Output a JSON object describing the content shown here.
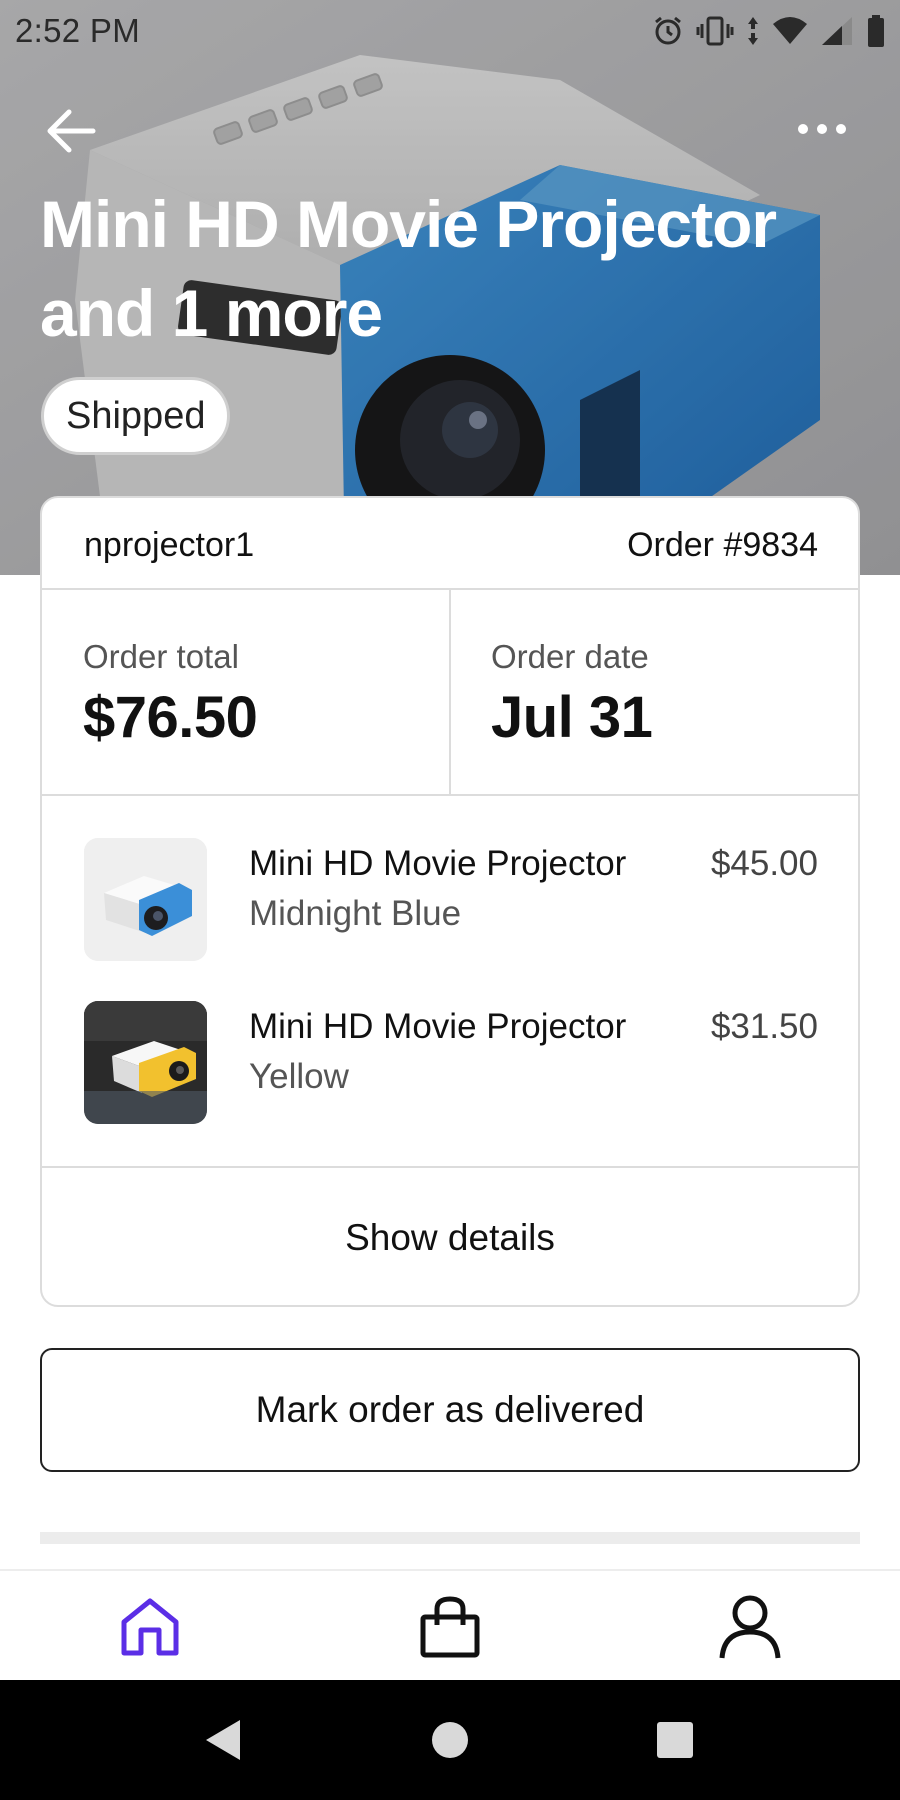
{
  "status_bar": {
    "time": "2:52 PM",
    "icons": [
      "alarm-icon",
      "vibrate-icon",
      "data-arrows-icon",
      "wifi-icon",
      "signal-icon",
      "battery-icon"
    ]
  },
  "hero": {
    "title": "Mini HD Movie Projector and 1 more",
    "status_badge": "Shipped",
    "back_icon": "arrow-left-icon",
    "more_icon": "more-horizontal-icon"
  },
  "order": {
    "seller": "nprojector1",
    "order_number": "Order #9834",
    "total_label": "Order total",
    "total_value": "$76.50",
    "date_label": "Order date",
    "date_value": "Jul 31",
    "items": [
      {
        "title": "Mini HD Movie Projector",
        "variant": "Midnight Blue",
        "price": "$45.00",
        "color": "#3b8fd8"
      },
      {
        "title": "Mini HD Movie Projector",
        "variant": "Yellow",
        "price": "$31.50",
        "color": "#f2c12e"
      }
    ],
    "show_details": "Show details"
  },
  "actions": {
    "mark_delivered": "Mark order as delivered"
  },
  "bottom_nav": {
    "items": [
      {
        "name": "home",
        "icon": "home-icon",
        "active": true
      },
      {
        "name": "bag",
        "icon": "shopping-bag-icon",
        "active": false
      },
      {
        "name": "profile",
        "icon": "person-icon",
        "active": false
      }
    ],
    "active_color": "#5b2ee6"
  },
  "system_nav": {
    "icons": [
      "system-back-icon",
      "system-home-icon",
      "system-recents-icon"
    ]
  }
}
